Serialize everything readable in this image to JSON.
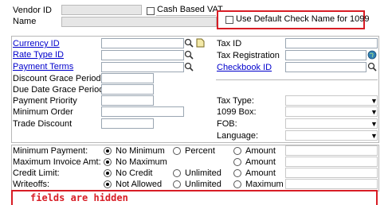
{
  "header": {
    "vendor_id_label": "Vendor ID",
    "name_label": "Name",
    "cash_based_vat_label": "Cash Based VAT",
    "use_default_check_label": "Use Default Check Name for 1099"
  },
  "left": {
    "currency_id_label": "Currency ID",
    "rate_type_id_label": "Rate Type ID",
    "payment_terms_label": "Payment Terms",
    "discount_grace_label": "Discount Grace Period",
    "due_date_grace_label": "Due Date Grace Period",
    "payment_priority_label": "Payment Priority",
    "minimum_order_label": "Minimum Order",
    "trade_discount_label": "Trade Discount"
  },
  "right": {
    "tax_id_label": "Tax ID",
    "tax_registration_label": "Tax Registration",
    "checkbook_id_label": "Checkbook ID",
    "tax_type_label": "Tax Type:",
    "box_1099_label": "1099 Box:",
    "fob_label": "FOB:",
    "language_label": "Language:"
  },
  "limits": {
    "minimum_payment_label": "Minimum Payment:",
    "maximum_invoice_label": "Maximum Invoice Amt:",
    "credit_limit_label": "Credit Limit:",
    "writeoffs_label": "Writeoffs:",
    "no_minimum": "No Minimum",
    "percent": "Percent",
    "amount": "Amount",
    "no_maximum": "No Maximum",
    "no_credit": "No Credit",
    "unlimited": "Unlimited",
    "not_allowed": "Not Allowed",
    "maximum": "Maximum"
  },
  "annotation": {
    "fields_hidden_text": "fields are hidden"
  },
  "icons": [
    "lookup-icon",
    "new-page-icon",
    "globe-icon",
    "dropdown-arrow-icon"
  ],
  "colors": {
    "link": "#0000cc",
    "annotation_red": "#d81d25",
    "globe": "#2f7fb6"
  }
}
